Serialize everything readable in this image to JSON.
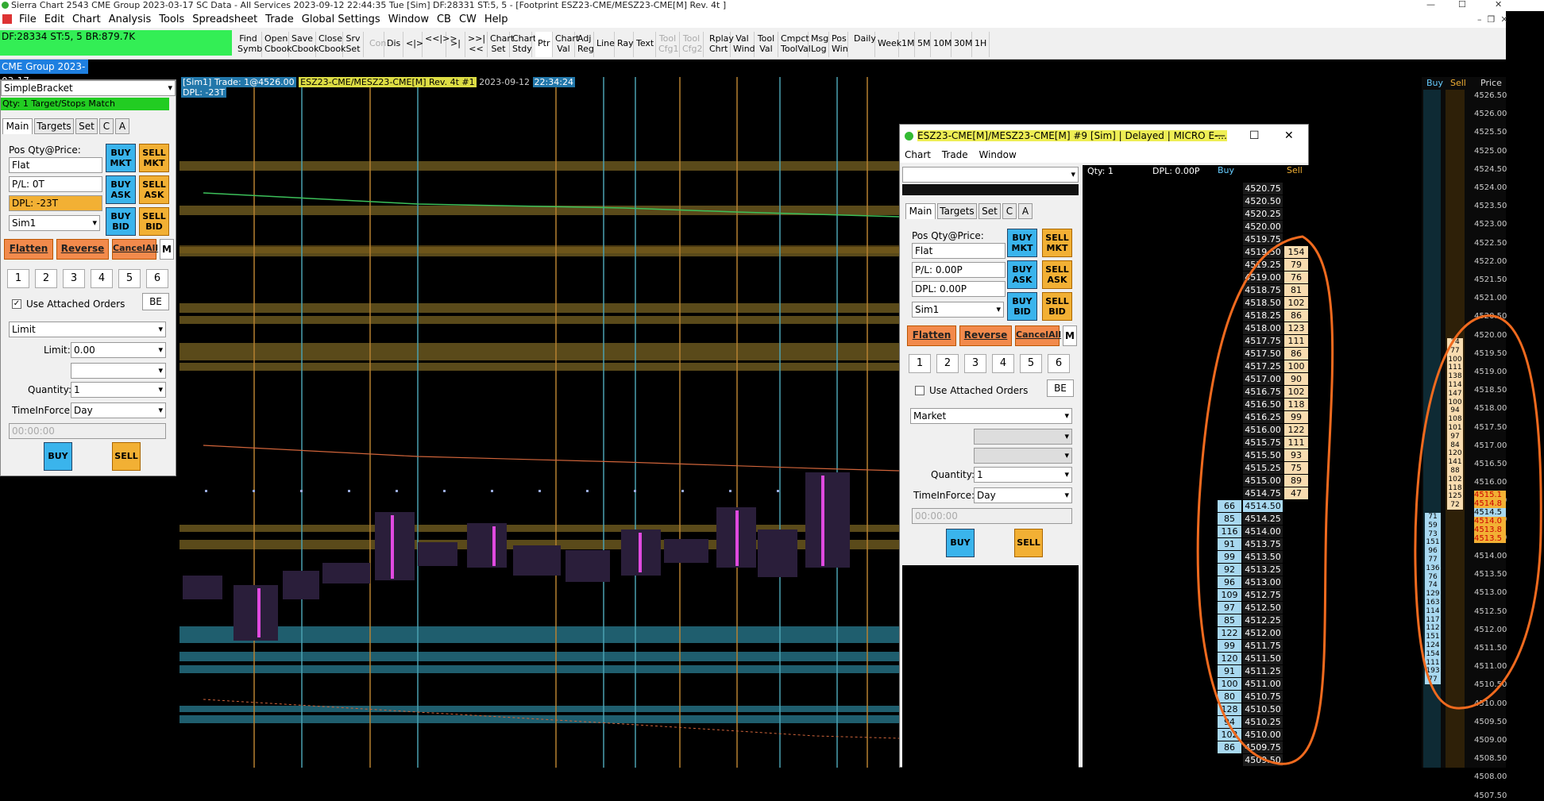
{
  "title_bar": {
    "text": "Sierra Chart 2543 CME Group 2023-03-17 SC Data - All Services 2023-09-12  22:44:35 Tue [Sim]  DF:28331  ST:5, 5 - [Footprint ESZ23-CME/MESZ23-CME[M]  Rev. 4t ]",
    "min": "—",
    "max": "☐",
    "close": "✕"
  },
  "menu": [
    "File",
    "Edit",
    "Chart",
    "Analysis",
    "Tools",
    "Spreadsheet",
    "Trade",
    "Global Settings",
    "Window",
    "CB",
    "CW",
    "Help"
  ],
  "status_box": {
    "line1": "DF:28334  ST:5, 5  BR:879.7K"
  },
  "toolbar": [
    {
      "id": "find-symb",
      "label": "Find Symb"
    },
    {
      "id": "open-cbook",
      "label": "Open Cbook"
    },
    {
      "id": "save-cbook",
      "label": "Save Cbook"
    },
    {
      "id": "close-cbook",
      "label": "Close Cbook"
    },
    {
      "id": "srv-set",
      "label": "Srv Set"
    },
    {
      "id": "con",
      "label": "Con",
      "disabled": true
    },
    {
      "id": "dis",
      "label": "Dis"
    },
    {
      "id": "scroll-l",
      "label": "<|>"
    },
    {
      "id": "scroll-ll",
      "label": "<<|>>"
    },
    {
      "id": "scroll-rl",
      "label": ">|<"
    },
    {
      "id": "scroll-rr",
      "label": ">>|<<"
    },
    {
      "id": "chart-set",
      "label": "Chart Set"
    },
    {
      "id": "chart-stdy",
      "label": "Chart Stdy"
    },
    {
      "id": "ptr",
      "label": "Ptr"
    },
    {
      "id": "chart-val",
      "label": "Chart Val"
    },
    {
      "id": "adj-reg",
      "label": "Adj Reg"
    },
    {
      "id": "line",
      "label": "Line"
    },
    {
      "id": "ray",
      "label": "Ray"
    },
    {
      "id": "text",
      "label": "Text"
    },
    {
      "id": "tool-cfg1",
      "label": "Tool Cfg1",
      "disabled": true
    },
    {
      "id": "tool-cfg2",
      "label": "Tool Cfg2",
      "disabled": true
    },
    {
      "id": "rplay-chrt",
      "label": "Rplay Chrt"
    },
    {
      "id": "val-wind",
      "label": "Val Wind"
    },
    {
      "id": "tool-val",
      "label": "Tool Val"
    },
    {
      "id": "cmpct-toolval",
      "label": "Cmpct ToolVal"
    },
    {
      "id": "msg-log",
      "label": "Msg Log"
    },
    {
      "id": "pos-win",
      "label": "Pos Win"
    },
    {
      "id": "daily",
      "label": "Daily"
    },
    {
      "id": "week",
      "label": "Week"
    },
    {
      "id": "1m",
      "label": "1M"
    },
    {
      "id": "5m",
      "label": "5M"
    },
    {
      "id": "10m",
      "label": "10M"
    },
    {
      "id": "30m",
      "label": "30M"
    },
    {
      "id": "1h",
      "label": "1H"
    }
  ],
  "cme_tab": "CME Group 2023-03-17",
  "left_panel": {
    "bracket": "SimpleBracket",
    "qty_match": "Qty: 1 Target/Stops Match",
    "tabs": [
      "Main",
      "Targets",
      "Set",
      "C",
      "A"
    ],
    "pos_label": "Pos Qty@Price:",
    "pos_value": "Flat",
    "pl": "P/L: 0T",
    "dpl": "DPL: -23T",
    "account": "Sim1",
    "buy_mkt": "BUY MKT",
    "sell_mkt": "SELL MKT",
    "buy_ask": "BUY ASK",
    "sell_ask": "SELL ASK",
    "buy_bid": "BUY BID",
    "sell_bid": "SELL BID",
    "flatten": "Flatten",
    "reverse": "Reverse",
    "cancel_all": "CancelAll",
    "m": "M",
    "nums": [
      "1",
      "2",
      "3",
      "4",
      "5",
      "6"
    ],
    "use_attached": "Use Attached Orders",
    "be": "BE",
    "order_type": "Limit",
    "limit_label": "Limit:",
    "limit_value": "0.00",
    "quantity_label": "Quantity:",
    "quantity": "1",
    "tif_label": "TimeInForce:",
    "tif": "Day",
    "time_placeholder": "00:00:00",
    "buy": "BUY",
    "sell": "SELL"
  },
  "chart_header": {
    "trade": "[Sim1]  Trade: 1@4526.00",
    "symbol": "ESZ23-CME/MESZ23-CME[M]  Rev. 4t #1",
    "date": "2023-09-12",
    "time": "22:34:24",
    "dpl": "DPL: -23T"
  },
  "popup": {
    "title": "ESZ23-CME[M]/MESZ23-CME[M] #9 [Sim]  | Delayed | MICRO E-...",
    "menu": [
      "Chart",
      "Trade",
      "Window"
    ],
    "tabs": [
      "Main",
      "Targets",
      "Set",
      "C",
      "A"
    ],
    "pos_label": "Pos Qty@Price:",
    "pos_value": "Flat",
    "pl": "P/L: 0.00P",
    "dpl": "DPL: 0.00P",
    "account": "Sim1",
    "flatten": "Flatten",
    "reverse": "Reverse",
    "cancel_all": "CancelAll",
    "m": "M",
    "nums": [
      "1",
      "2",
      "3",
      "4",
      "5",
      "6"
    ],
    "use_attached": "Use Attached Orders",
    "be": "BE",
    "order_type": "Market",
    "quantity_label": "Quantity:",
    "quantity": "1",
    "tif_label": "TimeInForce:",
    "tif": "Day",
    "time_placeholder": "00:00:00",
    "buy": "BUY",
    "sell": "SELL",
    "qty_hdr": "Qty: 1",
    "dpl_hdr": "DPL: 0.00P",
    "buy_hdr": "Buy",
    "sell_hdr": "Sell"
  },
  "dom": [
    {
      "p": "4520.75",
      "b": "",
      "s": ""
    },
    {
      "p": "4520.50",
      "b": "",
      "s": ""
    },
    {
      "p": "4520.25",
      "b": "",
      "s": ""
    },
    {
      "p": "4520.00",
      "b": "",
      "s": ""
    },
    {
      "p": "4519.75",
      "b": "",
      "s": ""
    },
    {
      "p": "4519.50",
      "b": "",
      "s": "154"
    },
    {
      "p": "4519.25",
      "b": "",
      "s": "79"
    },
    {
      "p": "4519.00",
      "b": "",
      "s": "76"
    },
    {
      "p": "4518.75",
      "b": "",
      "s": "81"
    },
    {
      "p": "4518.50",
      "b": "",
      "s": "102"
    },
    {
      "p": "4518.25",
      "b": "",
      "s": "86"
    },
    {
      "p": "4518.00",
      "b": "",
      "s": "123"
    },
    {
      "p": "4517.75",
      "b": "",
      "s": "111"
    },
    {
      "p": "4517.50",
      "b": "",
      "s": "86"
    },
    {
      "p": "4517.25",
      "b": "",
      "s": "100"
    },
    {
      "p": "4517.00",
      "b": "",
      "s": "90"
    },
    {
      "p": "4516.75",
      "b": "",
      "s": "102"
    },
    {
      "p": "4516.50",
      "b": "",
      "s": "118"
    },
    {
      "p": "4516.25",
      "b": "",
      "s": "99"
    },
    {
      "p": "4516.00",
      "b": "",
      "s": "122"
    },
    {
      "p": "4515.75",
      "b": "",
      "s": "111"
    },
    {
      "p": "4515.50",
      "b": "",
      "s": "93"
    },
    {
      "p": "4515.25",
      "b": "",
      "s": "75"
    },
    {
      "p": "4515.00",
      "b": "",
      "s": "89"
    },
    {
      "p": "4514.75",
      "b": "",
      "s": "47"
    },
    {
      "p": "4514.50",
      "b": "66",
      "s": ""
    },
    {
      "p": "4514.25",
      "b": "85",
      "s": ""
    },
    {
      "p": "4514.00",
      "b": "116",
      "s": ""
    },
    {
      "p": "4513.75",
      "b": "91",
      "s": ""
    },
    {
      "p": "4513.50",
      "b": "99",
      "s": ""
    },
    {
      "p": "4513.25",
      "b": "92",
      "s": ""
    },
    {
      "p": "4513.00",
      "b": "96",
      "s": ""
    },
    {
      "p": "4512.75",
      "b": "109",
      "s": ""
    },
    {
      "p": "4512.50",
      "b": "97",
      "s": ""
    },
    {
      "p": "4512.25",
      "b": "85",
      "s": ""
    },
    {
      "p": "4512.00",
      "b": "122",
      "s": ""
    },
    {
      "p": "4511.75",
      "b": "99",
      "s": ""
    },
    {
      "p": "4511.50",
      "b": "120",
      "s": ""
    },
    {
      "p": "4511.25",
      "b": "91",
      "s": ""
    },
    {
      "p": "4511.00",
      "b": "100",
      "s": ""
    },
    {
      "p": "4510.75",
      "b": "80",
      "s": ""
    },
    {
      "p": "4510.50",
      "b": "128",
      "s": ""
    },
    {
      "p": "4510.25",
      "b": "94",
      "s": ""
    },
    {
      "p": "4510.00",
      "b": "102",
      "s": ""
    },
    {
      "p": "4509.75",
      "b": "86",
      "s": ""
    },
    {
      "p": "4509.50",
      "b": "",
      "s": ""
    }
  ],
  "right_dom": {
    "buy_hdr": "Buy",
    "sell_hdr": "Sell",
    "price_hdr": "Price",
    "sell_col": [
      "74",
      "77",
      "100",
      "111",
      "138",
      "114",
      "147",
      "100",
      "94",
      "108",
      "101",
      "97",
      "84",
      "120",
      "141",
      "88",
      "102",
      "118",
      "125",
      "72"
    ],
    "buy_col": [
      "71",
      "59",
      "73",
      "151",
      "96",
      "77",
      "136",
      "76",
      "74",
      "129",
      "163",
      "114",
      "117",
      "112",
      "151",
      "124",
      "154",
      "111",
      "193",
      "77"
    ],
    "prices": [
      "4526.50",
      "4526.00",
      "4525.50",
      "4525.00",
      "4524.50",
      "4524.00",
      "4523.50",
      "4523.00",
      "4522.50",
      "4522.00",
      "4521.50",
      "4521.00",
      "4520.50",
      "4520.00",
      "4519.50",
      "4519.00",
      "4518.50",
      "4518.00",
      "4517.50",
      "4517.00",
      "4516.50",
      "4516.00",
      "4515.50",
      "4515.00",
      "4514.50",
      "4514.00",
      "4513.50",
      "4513.00",
      "4512.50",
      "4512.00",
      "4511.50",
      "4511.00",
      "4510.50",
      "4510.00",
      "4509.50",
      "4509.00",
      "4508.50",
      "4508.00",
      "4507.50"
    ],
    "near_prices": [
      "4515.1",
      "4514.8",
      "4514.5",
      "4514.0",
      "4513.8",
      "4513.5"
    ]
  },
  "colors": {
    "accent_blue": "#3ab4ec",
    "accent_yellow": "#f2b034",
    "orange": "#f28a4c",
    "annotation": "#f06a1e"
  }
}
